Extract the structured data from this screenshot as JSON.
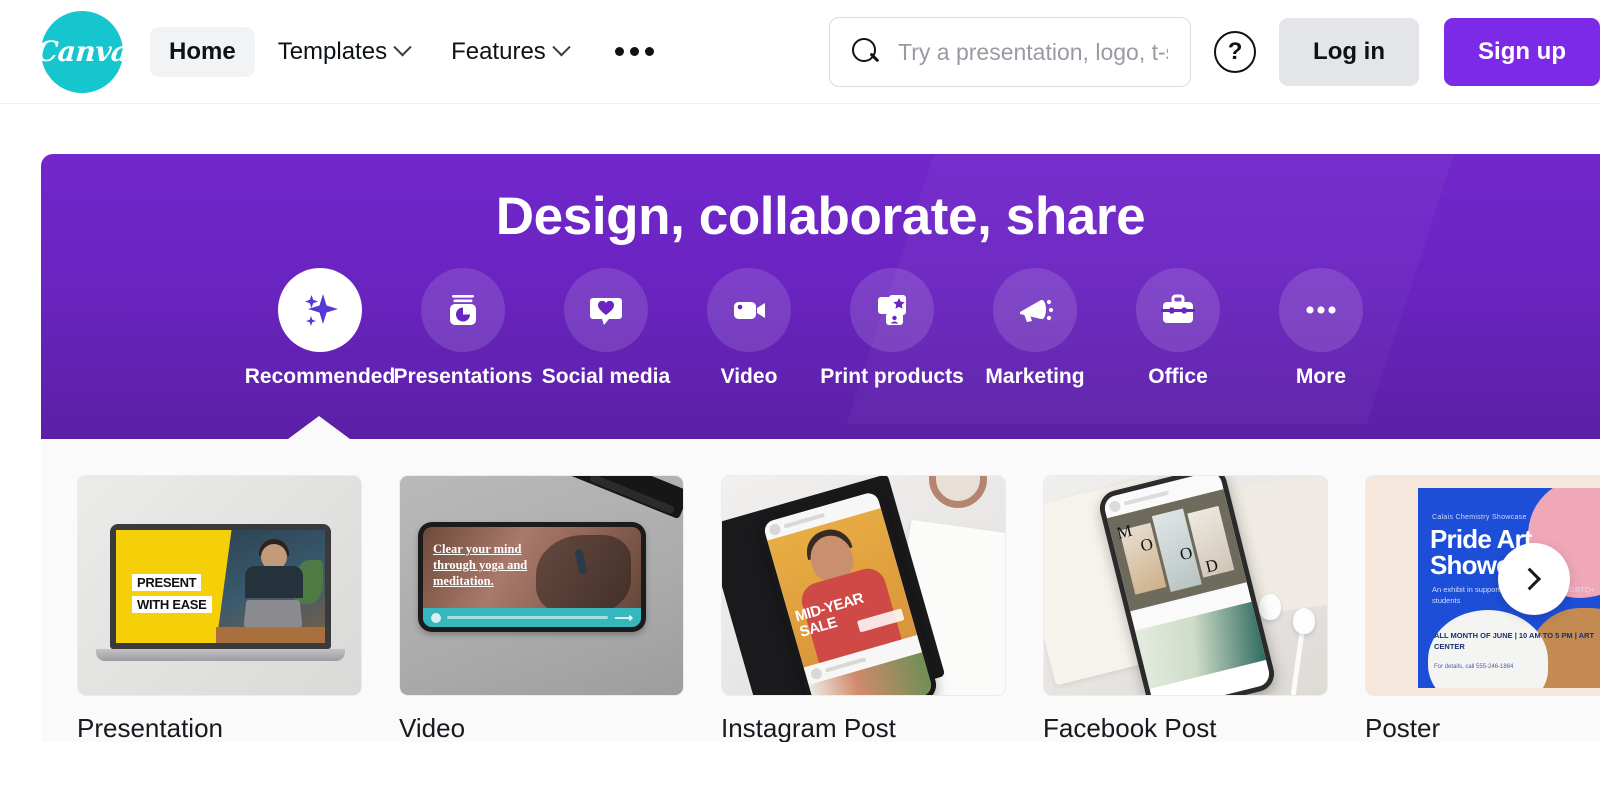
{
  "header": {
    "logo_text": "Canva",
    "nav": [
      {
        "label": "Home",
        "icon": "",
        "active": true
      },
      {
        "label": "Templates",
        "icon": "chevron-down-icon",
        "active": false
      },
      {
        "label": "Features",
        "icon": "chevron-down-icon",
        "active": false
      }
    ],
    "more_menu_icon": "ellipsis-icon",
    "search": {
      "icon": "search-icon",
      "placeholder": "Try a presentation, logo, t-sl",
      "value": ""
    },
    "help_icon_label": "?",
    "login_label": "Log in",
    "signup_label": "Sign up"
  },
  "hero": {
    "title": "Design, collaborate, share",
    "background_top": "#7227cc",
    "background_bottom": "#5b20a6",
    "categories": [
      {
        "label": "Recommended",
        "icon": "sparkles-icon",
        "active": true
      },
      {
        "label": "Presentations",
        "icon": "presentation-chart-icon",
        "active": false
      },
      {
        "label": "Social media",
        "icon": "heart-speech-bubble-icon",
        "active": false
      },
      {
        "label": "Video",
        "icon": "video-camera-icon",
        "active": false
      },
      {
        "label": "Print products",
        "icon": "print-cards-icon",
        "active": false
      },
      {
        "label": "Marketing",
        "icon": "megaphone-icon",
        "active": false
      },
      {
        "label": "Office",
        "icon": "briefcase-icon",
        "active": false
      },
      {
        "label": "More",
        "icon": "ellipsis-icon",
        "active": false
      }
    ]
  },
  "carousel": {
    "next_icon": "chevron-right-icon",
    "cards": [
      {
        "label": "Presentation",
        "thumb_text": {
          "line1": "PRESENT",
          "line2": "WITH EASE"
        }
      },
      {
        "label": "Video",
        "thumb_text": {
          "body": "Clear your mind through yoga and meditation."
        }
      },
      {
        "label": "Instagram Post",
        "thumb_text": {
          "line1": "MID-YEAR",
          "line2": "SALE"
        }
      },
      {
        "label": "Facebook Post",
        "thumb_text": {
          "m1": "M",
          "m2": "O",
          "m3": "O",
          "m4": "D"
        }
      },
      {
        "label": "Poster",
        "thumb_text": {
          "kicker": "Calais Chemistry Showcase",
          "title1": "Pride Art",
          "title2": "Showcase",
          "sub": "An exhibit in support and showcase our LGBTQ+ students",
          "info": "ALL MONTH OF JUNE | 10 AM TO 5 PM | ART CENTER",
          "foot": "For details, call 555-246-1864"
        }
      }
    ]
  },
  "colors": {
    "brand_teal": "#15c6ce",
    "accent_purple": "#7d2ae8",
    "hero_purple": "#6a24c0",
    "neutral_button": "#e4e5e8",
    "page_background": "#ffffff",
    "carousel_background": "#fafafa"
  }
}
